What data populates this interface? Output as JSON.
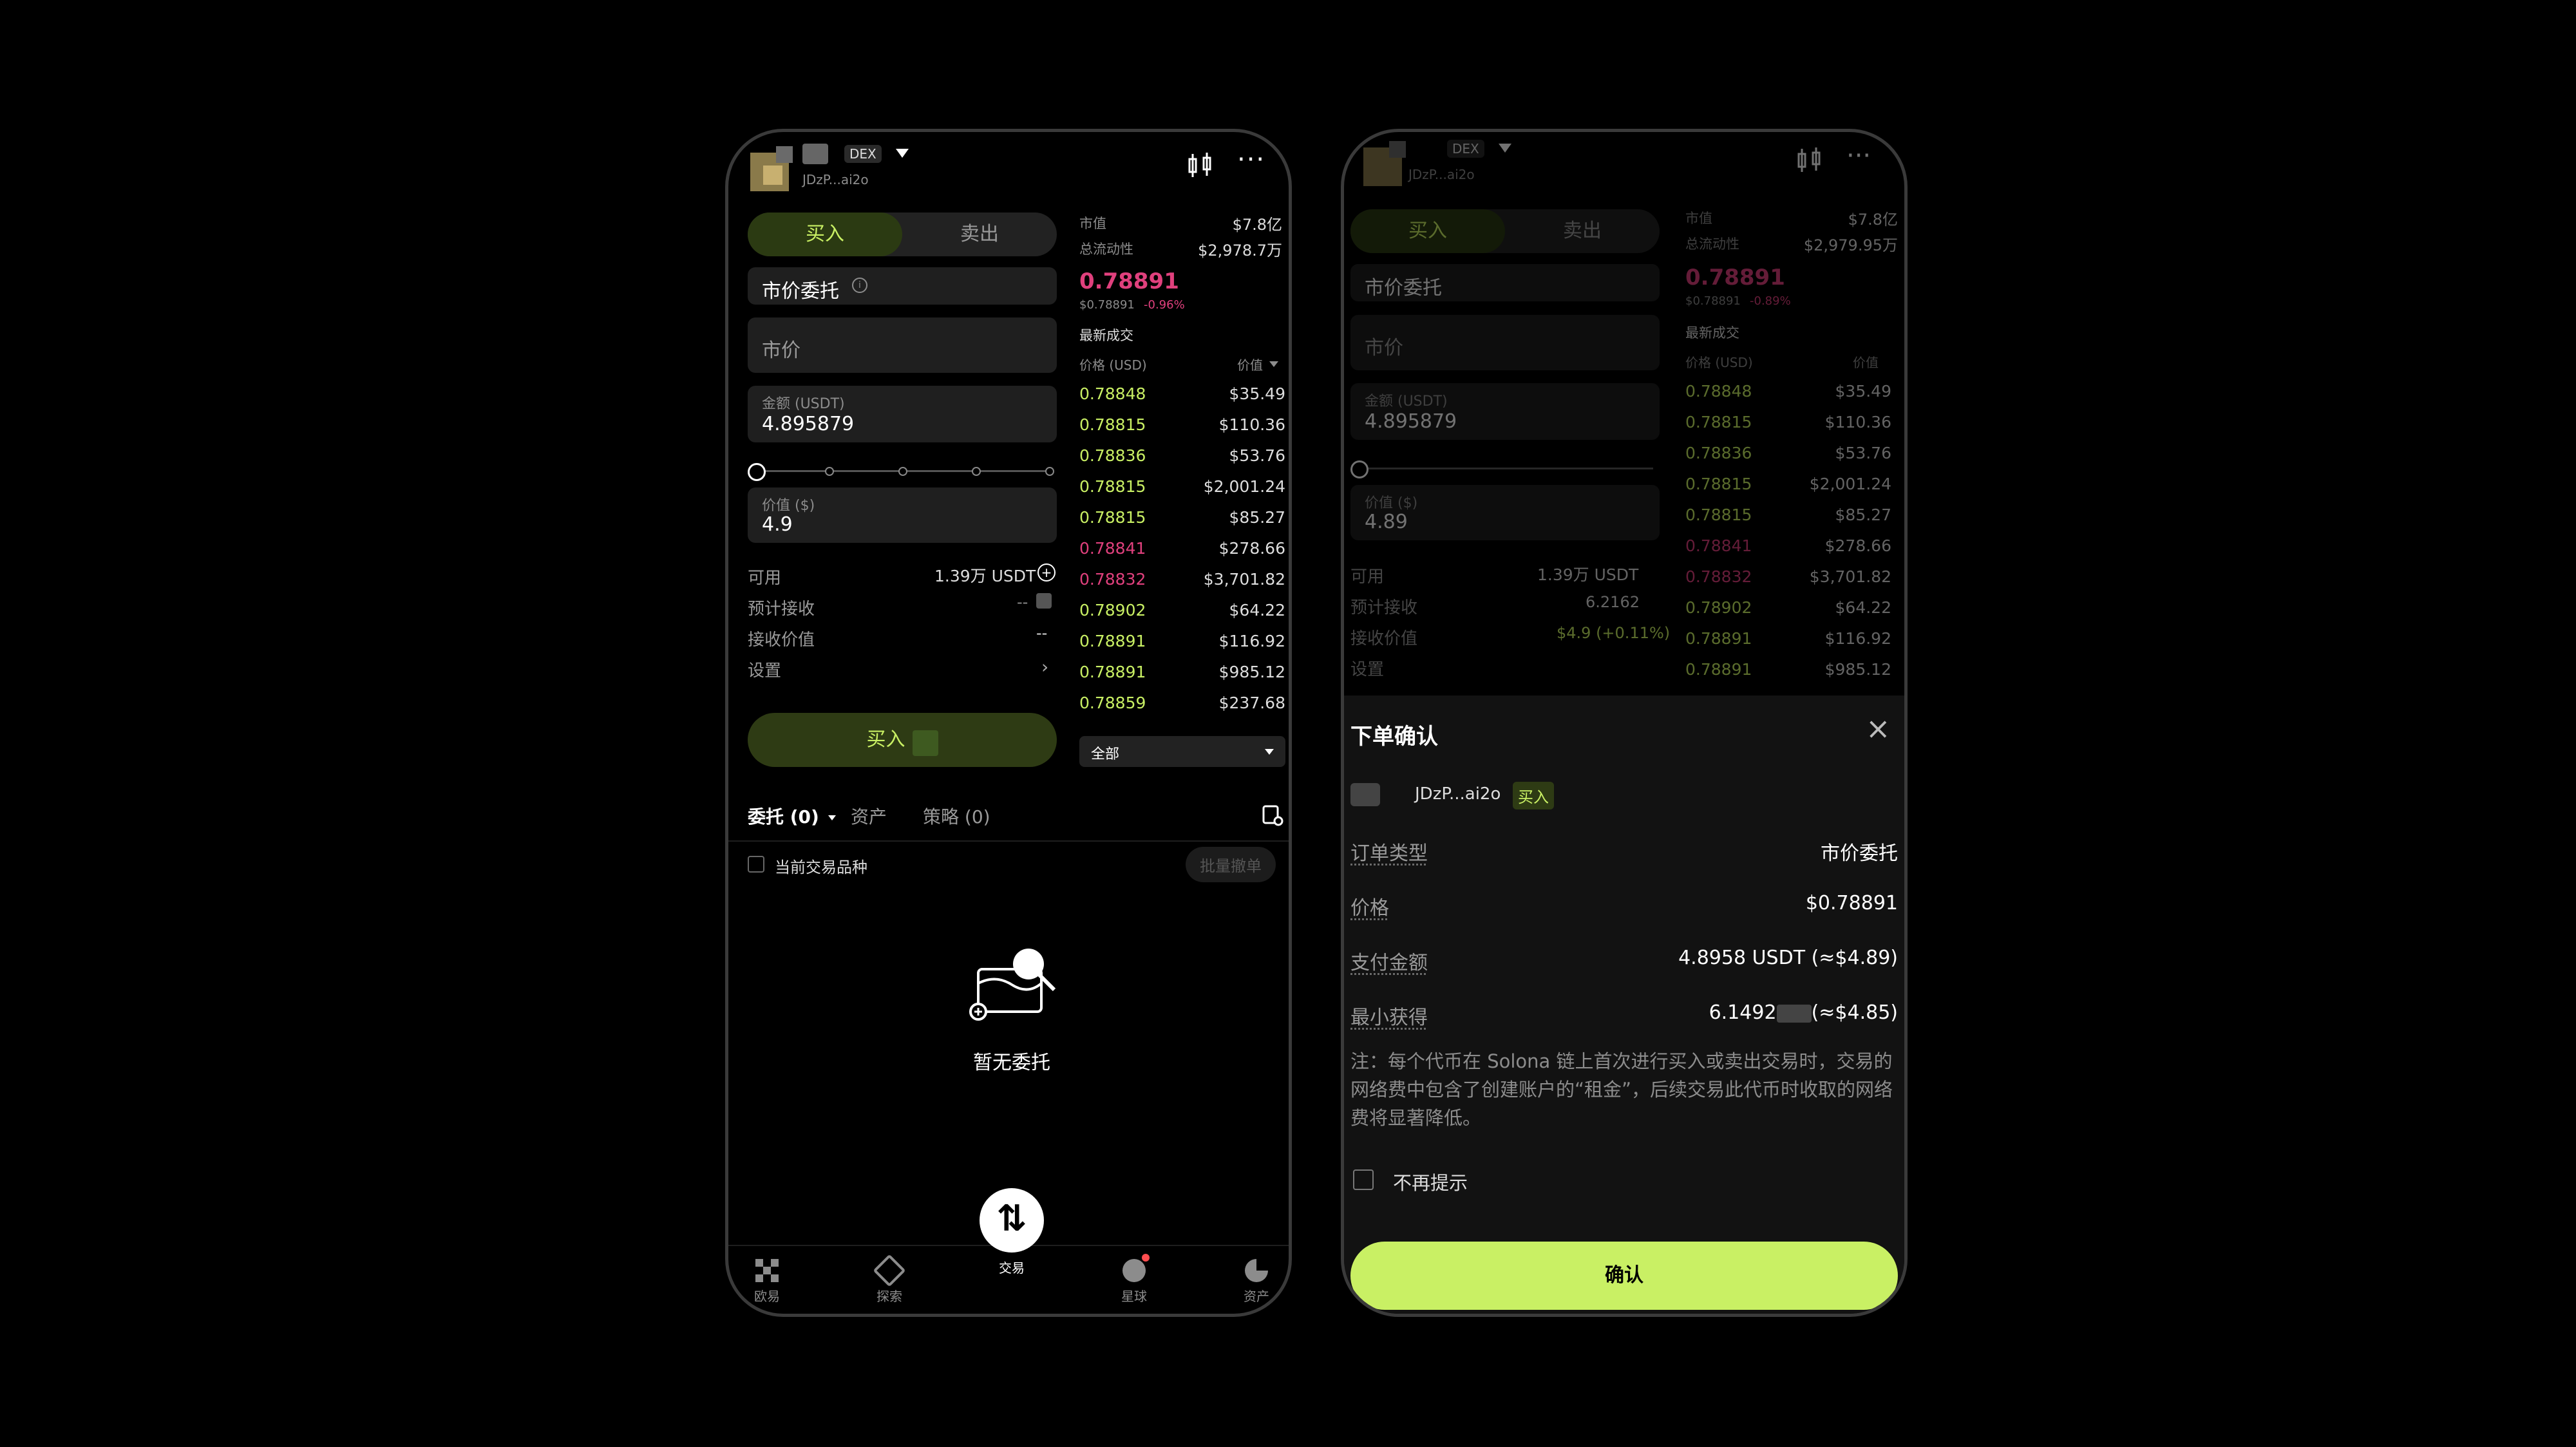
{
  "left_phone": {
    "header": {
      "dex_badge": "DEX",
      "token_address": "JDzP...ai2o"
    },
    "tabs": {
      "buy": "买入",
      "sell": "卖出"
    },
    "order_type": "市价委托",
    "price_placeholder": "市价",
    "amount": {
      "label": "金额 (USDT)",
      "value": "4.895879"
    },
    "value_field": {
      "label": "价值 ($)",
      "value": "4.9"
    },
    "available": {
      "label": "可用",
      "value": "1.39万 USDT"
    },
    "expected_receive": {
      "label": "预计接收",
      "value": "--"
    },
    "receive_value": {
      "label": "接收价值",
      "value": "--"
    },
    "settings": {
      "label": "设置"
    },
    "buy_button": "买入",
    "bottom_tabs": {
      "orders": "委托 (0)",
      "assets": "资产",
      "strategy": "策略 (0)"
    },
    "current_pair_label": "当前交易品种",
    "batch_cancel": "批量撤单",
    "empty_label": "暂无委托",
    "nav": [
      "欧易",
      "探索",
      "交易",
      "星球",
      "资产"
    ]
  },
  "stats": {
    "market_cap_label": "市值",
    "market_cap": "$7.8亿",
    "liquidity_label": "总流动性",
    "liquidity_left": "$2,978.7万",
    "liquidity_right": "$2,979.95万",
    "price": "0.78891",
    "sub_price": "$0.78891",
    "change": "-0.96%",
    "change_right": "-0.89%",
    "trades_label": "最新成交",
    "col_price": "价格 (USD)",
    "col_value": "价值",
    "filter": "全部"
  },
  "trades": [
    {
      "price": "0.78848",
      "value": "$35.49",
      "side": "buy"
    },
    {
      "price": "0.78815",
      "value": "$110.36",
      "side": "buy"
    },
    {
      "price": "0.78836",
      "value": "$53.76",
      "side": "buy"
    },
    {
      "price": "0.78815",
      "value": "$2,001.24",
      "side": "buy"
    },
    {
      "price": "0.78815",
      "value": "$85.27",
      "side": "buy"
    },
    {
      "price": "0.78841",
      "value": "$278.66",
      "side": "sell"
    },
    {
      "price": "0.78832",
      "value": "$3,701.82",
      "side": "sell"
    },
    {
      "price": "0.78902",
      "value": "$64.22",
      "side": "buy"
    },
    {
      "price": "0.78891",
      "value": "$116.92",
      "side": "buy"
    },
    {
      "price": "0.78891",
      "value": "$985.12",
      "side": "buy"
    },
    {
      "price": "0.78859",
      "value": "$237.68",
      "side": "buy"
    }
  ],
  "right_phone": {
    "value_field_value": "4.89",
    "expected_receive_value": "6.2162",
    "receive_value_value": "$4.9 (+0.11%)"
  },
  "confirm_sheet": {
    "title": "下单确认",
    "token_address": "JDzP...ai2o",
    "side_badge": "买入",
    "rows": {
      "order_type": {
        "label": "订单类型",
        "value": "市价委托"
      },
      "price": {
        "label": "价格",
        "value": "$0.78891"
      },
      "pay": {
        "label": "支付金额",
        "value": "4.8958 USDT (≈$4.89)"
      },
      "min_receive": {
        "label": "最小获得",
        "value_prefix": "6.1492",
        "value_suffix": "(≈$4.85)"
      }
    },
    "note": "注：每个代币在 Solona 链上首次进行买入或卖出交易时，交易的网络费中包含了创建账户的“租金”，后续交易此代币时收取的网络费将显著降低。",
    "dont_remind": "不再提示",
    "confirm_button": "确认"
  },
  "colors": {
    "accent": "#c9f064",
    "sell": "#e0407d",
    "buy": "#c9f064"
  }
}
